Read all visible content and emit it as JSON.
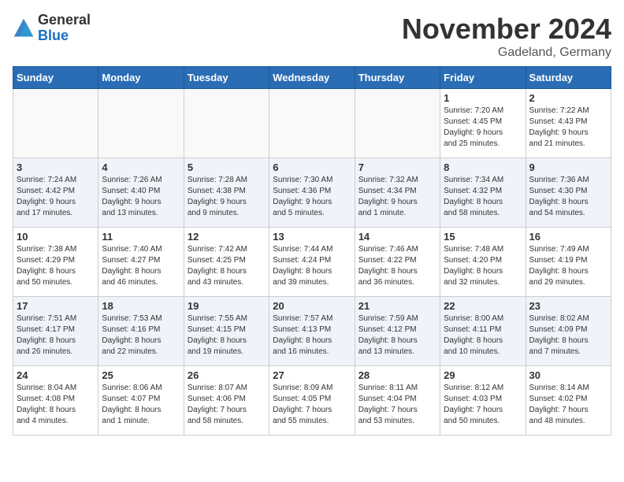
{
  "logo": {
    "general": "General",
    "blue": "Blue"
  },
  "header": {
    "month": "November 2024",
    "location": "Gadeland, Germany"
  },
  "weekdays": [
    "Sunday",
    "Monday",
    "Tuesday",
    "Wednesday",
    "Thursday",
    "Friday",
    "Saturday"
  ],
  "weeks": [
    [
      {
        "day": "",
        "info": ""
      },
      {
        "day": "",
        "info": ""
      },
      {
        "day": "",
        "info": ""
      },
      {
        "day": "",
        "info": ""
      },
      {
        "day": "",
        "info": ""
      },
      {
        "day": "1",
        "info": "Sunrise: 7:20 AM\nSunset: 4:45 PM\nDaylight: 9 hours\nand 25 minutes."
      },
      {
        "day": "2",
        "info": "Sunrise: 7:22 AM\nSunset: 4:43 PM\nDaylight: 9 hours\nand 21 minutes."
      }
    ],
    [
      {
        "day": "3",
        "info": "Sunrise: 7:24 AM\nSunset: 4:42 PM\nDaylight: 9 hours\nand 17 minutes."
      },
      {
        "day": "4",
        "info": "Sunrise: 7:26 AM\nSunset: 4:40 PM\nDaylight: 9 hours\nand 13 minutes."
      },
      {
        "day": "5",
        "info": "Sunrise: 7:28 AM\nSunset: 4:38 PM\nDaylight: 9 hours\nand 9 minutes."
      },
      {
        "day": "6",
        "info": "Sunrise: 7:30 AM\nSunset: 4:36 PM\nDaylight: 9 hours\nand 5 minutes."
      },
      {
        "day": "7",
        "info": "Sunrise: 7:32 AM\nSunset: 4:34 PM\nDaylight: 9 hours\nand 1 minute."
      },
      {
        "day": "8",
        "info": "Sunrise: 7:34 AM\nSunset: 4:32 PM\nDaylight: 8 hours\nand 58 minutes."
      },
      {
        "day": "9",
        "info": "Sunrise: 7:36 AM\nSunset: 4:30 PM\nDaylight: 8 hours\nand 54 minutes."
      }
    ],
    [
      {
        "day": "10",
        "info": "Sunrise: 7:38 AM\nSunset: 4:29 PM\nDaylight: 8 hours\nand 50 minutes."
      },
      {
        "day": "11",
        "info": "Sunrise: 7:40 AM\nSunset: 4:27 PM\nDaylight: 8 hours\nand 46 minutes."
      },
      {
        "day": "12",
        "info": "Sunrise: 7:42 AM\nSunset: 4:25 PM\nDaylight: 8 hours\nand 43 minutes."
      },
      {
        "day": "13",
        "info": "Sunrise: 7:44 AM\nSunset: 4:24 PM\nDaylight: 8 hours\nand 39 minutes."
      },
      {
        "day": "14",
        "info": "Sunrise: 7:46 AM\nSunset: 4:22 PM\nDaylight: 8 hours\nand 36 minutes."
      },
      {
        "day": "15",
        "info": "Sunrise: 7:48 AM\nSunset: 4:20 PM\nDaylight: 8 hours\nand 32 minutes."
      },
      {
        "day": "16",
        "info": "Sunrise: 7:49 AM\nSunset: 4:19 PM\nDaylight: 8 hours\nand 29 minutes."
      }
    ],
    [
      {
        "day": "17",
        "info": "Sunrise: 7:51 AM\nSunset: 4:17 PM\nDaylight: 8 hours\nand 26 minutes."
      },
      {
        "day": "18",
        "info": "Sunrise: 7:53 AM\nSunset: 4:16 PM\nDaylight: 8 hours\nand 22 minutes."
      },
      {
        "day": "19",
        "info": "Sunrise: 7:55 AM\nSunset: 4:15 PM\nDaylight: 8 hours\nand 19 minutes."
      },
      {
        "day": "20",
        "info": "Sunrise: 7:57 AM\nSunset: 4:13 PM\nDaylight: 8 hours\nand 16 minutes."
      },
      {
        "day": "21",
        "info": "Sunrise: 7:59 AM\nSunset: 4:12 PM\nDaylight: 8 hours\nand 13 minutes."
      },
      {
        "day": "22",
        "info": "Sunrise: 8:00 AM\nSunset: 4:11 PM\nDaylight: 8 hours\nand 10 minutes."
      },
      {
        "day": "23",
        "info": "Sunrise: 8:02 AM\nSunset: 4:09 PM\nDaylight: 8 hours\nand 7 minutes."
      }
    ],
    [
      {
        "day": "24",
        "info": "Sunrise: 8:04 AM\nSunset: 4:08 PM\nDaylight: 8 hours\nand 4 minutes."
      },
      {
        "day": "25",
        "info": "Sunrise: 8:06 AM\nSunset: 4:07 PM\nDaylight: 8 hours\nand 1 minute."
      },
      {
        "day": "26",
        "info": "Sunrise: 8:07 AM\nSunset: 4:06 PM\nDaylight: 7 hours\nand 58 minutes."
      },
      {
        "day": "27",
        "info": "Sunrise: 8:09 AM\nSunset: 4:05 PM\nDaylight: 7 hours\nand 55 minutes."
      },
      {
        "day": "28",
        "info": "Sunrise: 8:11 AM\nSunset: 4:04 PM\nDaylight: 7 hours\nand 53 minutes."
      },
      {
        "day": "29",
        "info": "Sunrise: 8:12 AM\nSunset: 4:03 PM\nDaylight: 7 hours\nand 50 minutes."
      },
      {
        "day": "30",
        "info": "Sunrise: 8:14 AM\nSunset: 4:02 PM\nDaylight: 7 hours\nand 48 minutes."
      }
    ]
  ]
}
